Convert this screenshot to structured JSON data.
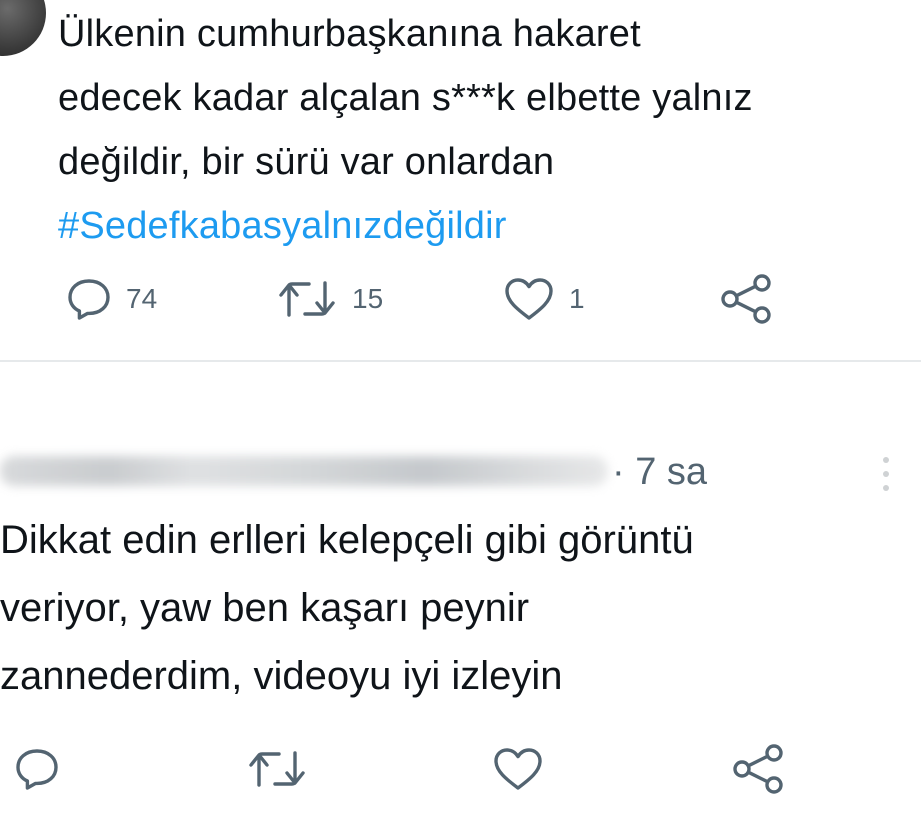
{
  "tweet1": {
    "text_lines": [
      "Ülkenin cumhurbaşkanına hakaret",
      "edecek kadar alçalan s***k elbette yalnız",
      "değildir, bir sürü var onlardan"
    ],
    "hashtag": "#Sedefkabasyalnızdeğildir",
    "actions": {
      "replies": "74",
      "retweets": "15",
      "likes": "1"
    }
  },
  "tweet2": {
    "time": "· 7 sa",
    "text_lines": [
      "Dikkat edin erlleri kelepçeli gibi görüntü",
      "veriyor, yaw ben kaşarı peynir",
      "zannederdim, videoyu iyi izleyin"
    ]
  },
  "icons": {
    "reply": "reply-icon",
    "retweet": "retweet-icon",
    "like": "like-icon",
    "share": "share-icon",
    "more": "more-icon"
  },
  "colors": {
    "text": "#0f1419",
    "secondary": "#536471",
    "link": "#1d9bf0",
    "divider": "#e6e9eb"
  }
}
